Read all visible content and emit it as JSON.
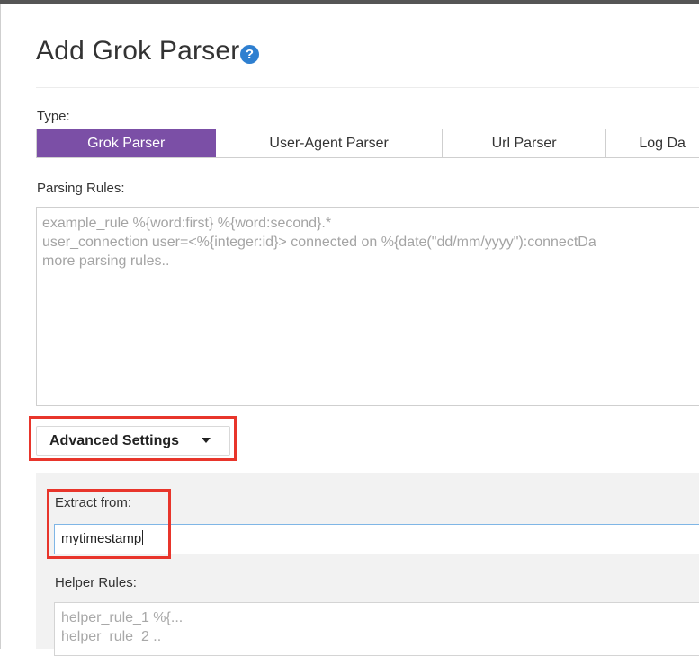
{
  "dialog": {
    "title": "Add Grok Parser",
    "help_glyph": "?"
  },
  "type_section": {
    "label": "Type:",
    "options": [
      "Grok Parser",
      "User-Agent Parser",
      "Url Parser",
      "Log Da"
    ],
    "selected": "Grok Parser"
  },
  "parsing_rules": {
    "label": "Parsing Rules:",
    "placeholder": "example_rule %{word:first} %{word:second}.*\nuser_connection user=<%{integer:id}> connected on %{date(\"dd/mm/yyyy\"):connectDa\nmore parsing rules.."
  },
  "advanced": {
    "toggle_label": "Advanced Settings",
    "extract_from": {
      "label": "Extract from:",
      "value": "mytimestamp"
    },
    "helper_rules": {
      "label": "Helper Rules:",
      "placeholder": "helper_rule_1 %{...\nhelper_rule_2 .."
    }
  },
  "colors": {
    "accent_purple": "#7b4fa6",
    "help_blue": "#2e7fd0",
    "highlight_red": "#e8352b",
    "focus_blue": "#7fb6e6"
  }
}
